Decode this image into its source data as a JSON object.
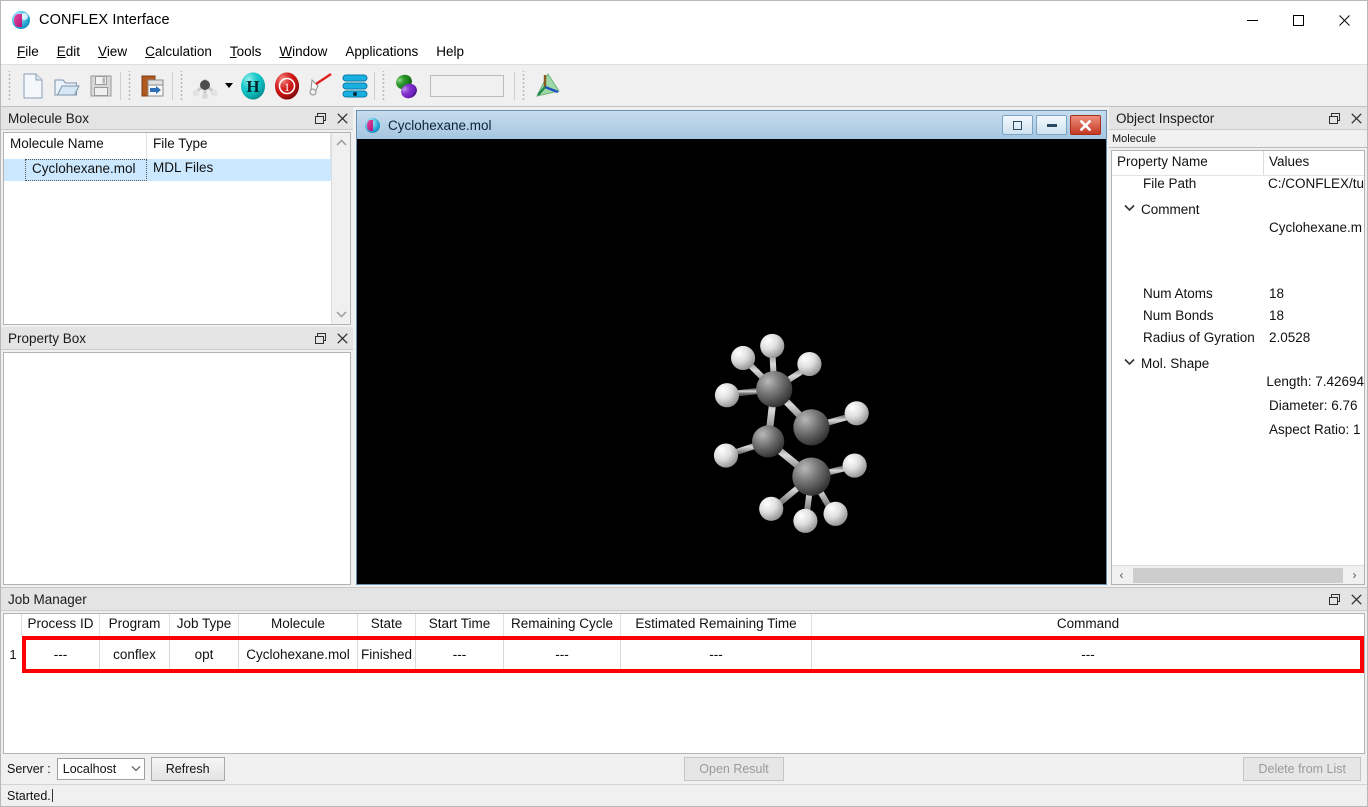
{
  "window": {
    "title": "CONFLEX Interface",
    "logo_icon": "conflex-logo-icon",
    "minimize": "—",
    "maximize": "☐",
    "close": "✕"
  },
  "menubar": {
    "items": [
      {
        "label": "File",
        "accel": "F"
      },
      {
        "label": "Edit",
        "accel": "E"
      },
      {
        "label": "View",
        "accel": "V"
      },
      {
        "label": "Calculation",
        "accel": "C"
      },
      {
        "label": "Tools",
        "accel": "T"
      },
      {
        "label": "Window",
        "accel": "W"
      },
      {
        "label": "Applications",
        "accel": ""
      },
      {
        "label": "Help",
        "accel": ""
      }
    ]
  },
  "toolbar": {
    "buttons": [
      {
        "name": "new-file-icon",
        "tip": "New"
      },
      {
        "name": "open-folder-icon",
        "tip": "Open"
      },
      {
        "name": "save-icon",
        "tip": "Save"
      },
      {
        "name": "import-molecule-icon",
        "tip": "Import"
      },
      {
        "name": "molecule-model-icon",
        "tip": "Molecule Model"
      },
      {
        "name": "add-hydrogen-icon",
        "tip": "Add Hydrogen"
      },
      {
        "name": "formal-charge-icon",
        "tip": "Formal Charge"
      },
      {
        "name": "clean-structure-icon",
        "tip": "Clean"
      },
      {
        "name": "conformation-list-icon",
        "tip": "Conformations"
      },
      {
        "name": "orbital-icon",
        "tip": "Orbitals"
      },
      {
        "name": "axes-icon",
        "tip": "Axes"
      }
    ],
    "combo_value": ""
  },
  "molecule_box": {
    "title": "Molecule Box",
    "columns": [
      "Molecule Name",
      "File Type"
    ],
    "rows": [
      {
        "name": "Cyclohexane.mol",
        "type": "MDL Files"
      }
    ]
  },
  "property_box": {
    "title": "Property Box",
    "content": ""
  },
  "viewer": {
    "title": "Cyclohexane.mol",
    "restore_glyph": "▣",
    "minimize_glyph": "—",
    "close_glyph": "✕",
    "background": "#000000"
  },
  "object_inspector": {
    "title": "Object Inspector",
    "tab": "Molecule",
    "columns": [
      "Property Name",
      "Values"
    ],
    "rows": [
      {
        "name": "File Path",
        "value": "C:/CONFLEX/tu",
        "expandable": false,
        "indent": true
      },
      {
        "name": "Comment",
        "value": "",
        "expandable": true,
        "indent": false
      },
      {
        "name": "",
        "value": "Cyclohexane.m",
        "expandable": false,
        "indent": true
      },
      {
        "name": "",
        "value": "",
        "expandable": false,
        "indent": true
      },
      {
        "name": "",
        "value": "",
        "expandable": false,
        "indent": true
      },
      {
        "name": "Num Atoms",
        "value": "18",
        "expandable": false,
        "indent": true
      },
      {
        "name": "Num Bonds",
        "value": "18",
        "expandable": false,
        "indent": true
      },
      {
        "name": "Radius of Gyration",
        "value": "2.0528",
        "expandable": false,
        "indent": true
      },
      {
        "name": "Mol. Shape",
        "value": "",
        "expandable": true,
        "indent": false
      },
      {
        "name": "",
        "value": "Length: 7.42694",
        "expandable": false,
        "indent": true
      },
      {
        "name": "",
        "value": "Diameter: 6.76",
        "expandable": false,
        "indent": true
      },
      {
        "name": "",
        "value": "Aspect Ratio: 1",
        "expandable": false,
        "indent": true
      }
    ],
    "hscroll_left": "‹",
    "hscroll_right": "›"
  },
  "job_manager": {
    "title": "Job Manager",
    "columns": [
      "Process ID",
      "Program",
      "Job Type",
      "Molecule",
      "State",
      "Start Time",
      "Remaining Cycle",
      "Estimated Remaining Time",
      "Command"
    ],
    "rows": [
      {
        "index": "1",
        "process_id": "---",
        "program": "conflex",
        "job_type": "opt",
        "molecule": "Cyclohexane.mol",
        "state": "Finished",
        "start_time": "---",
        "remaining_cycle": "---",
        "estimated_remaining_time": "---",
        "command": "---",
        "highlighted": true,
        "highlight_color": "#ff0000"
      }
    ],
    "footer": {
      "server_label": "Server :",
      "server_value": "Localhost",
      "refresh_label": "Refresh",
      "open_result_label": "Open Result",
      "open_result_enabled": false,
      "delete_label": "Delete from List",
      "delete_enabled": false
    }
  },
  "statusbar": {
    "text": "Started."
  },
  "panel_controls": {
    "float_glyph": "❐",
    "close_glyph": "✕"
  }
}
